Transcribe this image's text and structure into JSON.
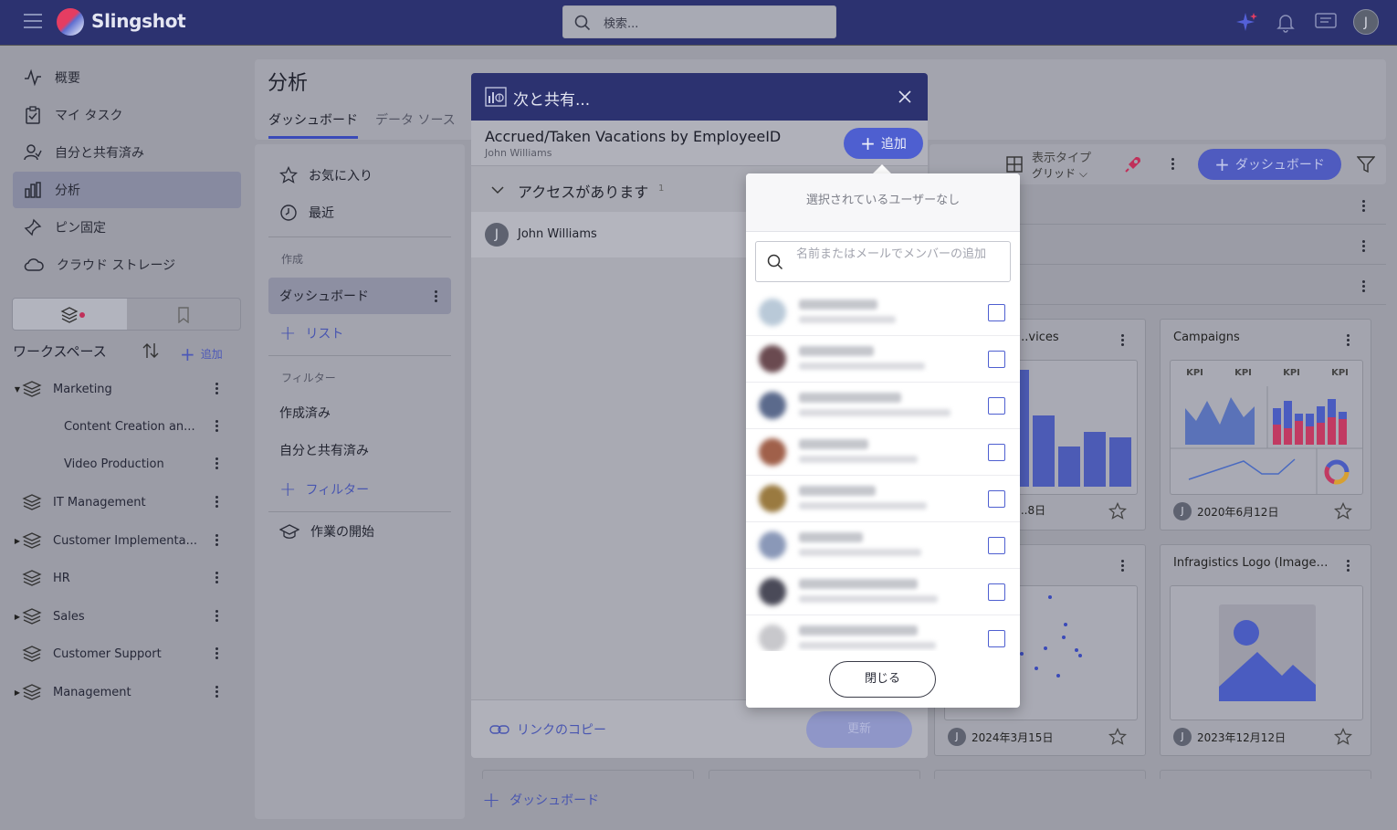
{
  "app": {
    "brand": "Slingshot",
    "avatar_initial": "J"
  },
  "search": {
    "placeholder": "検索..."
  },
  "sidebar": {
    "nav": [
      {
        "label": "概要",
        "icon": "activity-icon"
      },
      {
        "label": "マイ タスク",
        "icon": "clipboard-check-icon"
      },
      {
        "label": "自分と共有済み",
        "icon": "user-share-icon"
      },
      {
        "label": "分析",
        "icon": "bar-chart-icon",
        "active": true
      },
      {
        "label": "ピン固定",
        "icon": "pin-icon"
      },
      {
        "label": "クラウド ストレージ",
        "icon": "cloud-icon"
      }
    ],
    "workspace_label": "ワークスペース",
    "add_label": "追加",
    "workspaces": [
      {
        "label": "Marketing",
        "expanded": true
      },
      {
        "label": "Content Creation an...",
        "child": true
      },
      {
        "label": "Video Production",
        "child": true
      },
      {
        "label": "IT Management"
      },
      {
        "label": "Customer Implementa...",
        "has_children": true
      },
      {
        "label": "HR"
      },
      {
        "label": "Sales",
        "has_children": true
      },
      {
        "label": "Customer Support"
      },
      {
        "label": "Management",
        "has_children": true
      }
    ]
  },
  "main": {
    "title": "分析",
    "tabs": [
      "ダッシュボード",
      "データ ソース"
    ],
    "left_panel": {
      "favorites": "お気に入り",
      "recent": "最近",
      "create_section": "作成",
      "dashboard": "ダッシュボード",
      "list": "リスト",
      "filter_section": "フィルター",
      "created": "作成済み",
      "shared_with_me": "自分と共有済み",
      "add_filter": "フィルター",
      "getting_started": "作業の開始"
    },
    "view_type_label": "表示タイプ",
    "view_type_value": "グリッド",
    "new_dashboard_btn": "ダッシュボード",
    "bottom_add_dashboard": "ダッシュボード",
    "cards": [
      {
        "title": "...vices",
        "date": "...8日"
      },
      {
        "title": "Campaigns",
        "date": "2020年6月12日",
        "initial": "J"
      },
      {
        "title": "",
        "date": "2024年3月15日",
        "initial": "J"
      },
      {
        "title": "Infragistics Logo (Image ...",
        "date": "2023年12月12日",
        "initial": "J"
      }
    ],
    "kpi_labels": [
      "KPI",
      "KPI",
      "KPI",
      "KPI"
    ]
  },
  "dialog": {
    "title": "次と共有...",
    "dashboard_name": "Accrued/Taken Vacations by EmployeeID",
    "owner": "John Williams",
    "add_label": "追加",
    "access_label": "アクセスがあります",
    "access_count": "1",
    "user_initial": "J",
    "user_name": "John Williams",
    "copy_link": "リンクのコピー",
    "update": "更新"
  },
  "popup": {
    "no_selection": "選択されているユーザーなし",
    "search_placeholder": "名前またはメールでメンバーの追加",
    "close": "閉じる",
    "members": [
      {
        "avatar_color": "#b9c9d8"
      },
      {
        "avatar_color": "#6a4a50"
      },
      {
        "avatar_color": "#5b6a8c"
      },
      {
        "avatar_color": "#a0604a"
      },
      {
        "avatar_color": "#9a7a40"
      },
      {
        "avatar_color": "#8a98b8"
      },
      {
        "avatar_color": "#4a4a58"
      },
      {
        "avatar_color": "#c8c8cc"
      }
    ]
  },
  "colors": {
    "brand_navy": "#2c3270",
    "accent_blue": "#4e5fd0",
    "accent_red": "#e53d62"
  }
}
